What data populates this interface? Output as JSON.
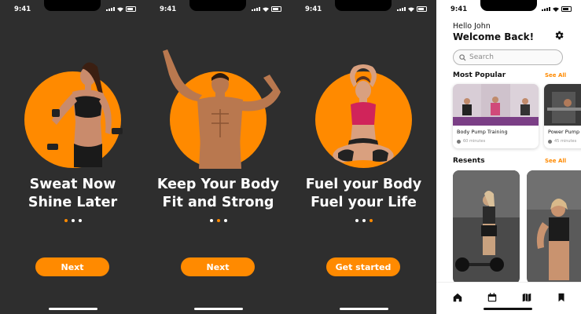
{
  "status": {
    "time": "9:41"
  },
  "onboarding": [
    {
      "line1": "Sweat Now",
      "line2": "Shine Later",
      "active_dot": 0,
      "button": "Next"
    },
    {
      "line1": "Keep Your Body",
      "line2": "Fit and Strong",
      "active_dot": 1,
      "button": "Next"
    },
    {
      "line1": "Fuel your Body",
      "line2": "Fuel your Life",
      "active_dot": 2,
      "button": "Get started"
    }
  ],
  "home": {
    "greeting": "Hello John",
    "welcome": "Welcome Back!",
    "search_placeholder": "Search",
    "most_popular": "Most Popular",
    "see_all": "See All",
    "cards": [
      {
        "name": "Body Pump Training",
        "duration": "60 minutes"
      },
      {
        "name": "Power Pump",
        "duration": "45 minutes"
      }
    ],
    "recents": "Resents",
    "recents_see_all": "See All",
    "tabs": [
      "home-icon",
      "calendar-icon",
      "map-icon",
      "bookmark-icon"
    ]
  },
  "colors": {
    "accent": "#ff8a00",
    "dark_bg": "#2e2e2e"
  }
}
